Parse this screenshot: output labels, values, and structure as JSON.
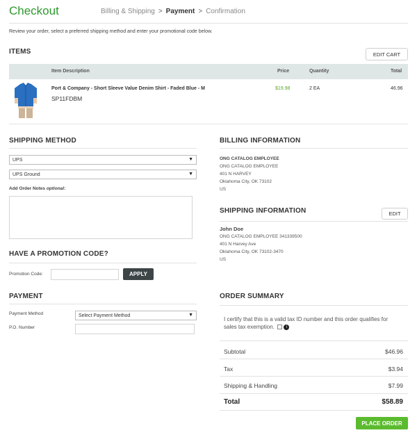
{
  "header": {
    "title": "Checkout",
    "breadcrumb": [
      "Billing & Shipping",
      "Payment",
      "Confirmation"
    ],
    "separator": ">",
    "intro": "Review your order, select a preferred shipping method and enter your promotional code below."
  },
  "items": {
    "heading": "ITEMS",
    "edit_cart_label": "EDIT CART",
    "columns": [
      "Item Description",
      "Price",
      "Quantity",
      "Total"
    ],
    "rows": [
      {
        "image_icon": "shirt-thumbnail",
        "description": "Port & Company - Short Sleeve Value Denim Shirt - Faded Blue - M",
        "sku": "SP11FDBM",
        "price": "$19.98",
        "quantity": "2 EA",
        "total": "46.96"
      }
    ]
  },
  "shipping_method": {
    "heading": "SHIPPING METHOD",
    "carrier": "UPS",
    "service": "UPS Ground",
    "notes_label": "Add Order Notes",
    "notes_optional": "optional:"
  },
  "promotion": {
    "heading": "HAVE A PROMOTION CODE?",
    "label": "Promotion Code:",
    "value": "",
    "apply_label": "APPLY"
  },
  "payment": {
    "heading": "PAYMENT",
    "method_label": "Payment Method",
    "method_value": "Select Payment Method",
    "po_label": "P.O. Number",
    "po_value": ""
  },
  "billing": {
    "heading": "BILLING INFORMATION",
    "lines": [
      "ONG CATALOG EMPLOYEE",
      "ONG CATALOG EMPLOYEE",
      "401 N HARVEY",
      "Oklahoma City, OK 73102",
      "US"
    ]
  },
  "shipping_info": {
    "heading": "SHIPPING INFORMATION",
    "edit_label": "EDIT",
    "lines": [
      "John  Doe",
      "ONG CATALOG EMPLOYEE 341339500",
      "401 N Harvey Ave",
      "Oklahoma City, OK 73102-3470",
      "US"
    ]
  },
  "summary": {
    "heading": "ORDER SUMMARY",
    "tax_certify": "I certify that this is a valid tax ID number and this order qualifies for sales tax exemption.",
    "subtotal_label": "Subtotal",
    "subtotal": "$46.96",
    "tax_label": "Tax",
    "tax": "$3.94",
    "shipping_label": "Shipping & Handling",
    "shipping": "$7.99",
    "total_label": "Total",
    "total": "$58.89",
    "place_order_label": "PLACE ORDER"
  },
  "colors": {
    "brand_green": "#2e9a2e",
    "button_green": "#5bbb2e",
    "price_green": "#5aa92a",
    "button_dark": "#3e4547"
  }
}
